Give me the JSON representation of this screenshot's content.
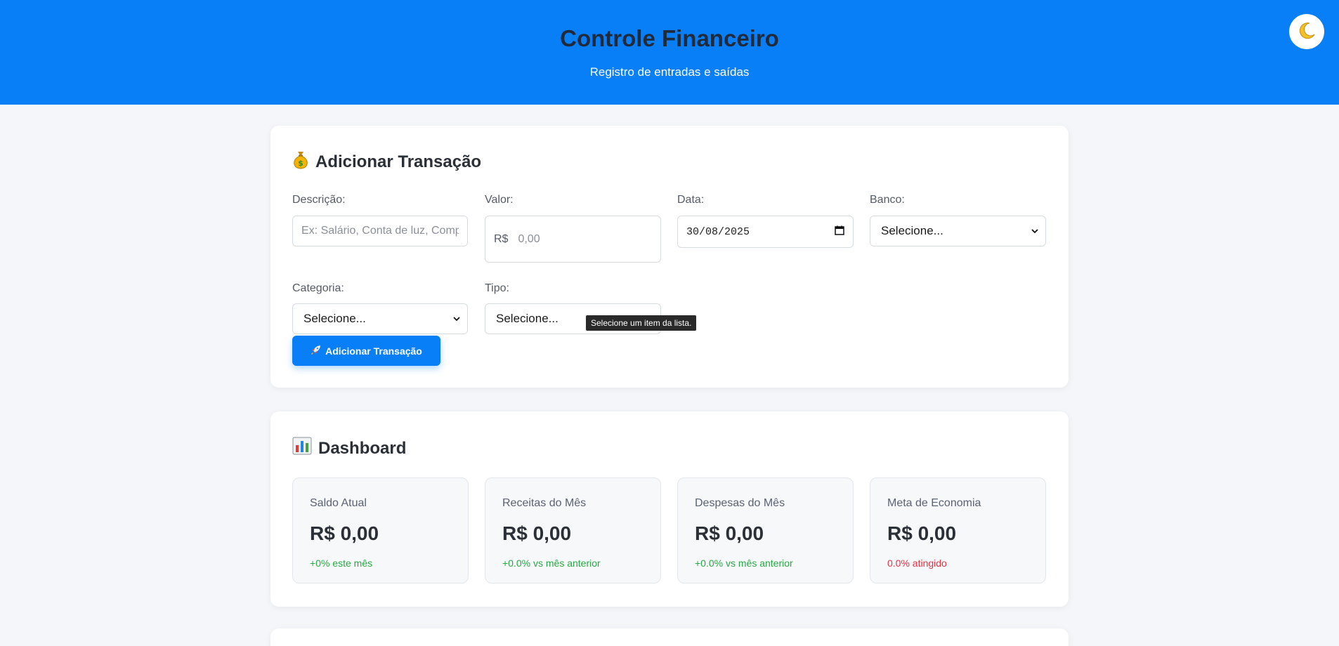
{
  "header": {
    "title": "Controle Financeiro",
    "subtitle": "Registro de entradas e saídas",
    "theme_toggle_icon": "crescent-moon-icon"
  },
  "form": {
    "title": "Adicionar Transação",
    "title_icon": "money-bag-icon",
    "description": {
      "label": "Descrição:",
      "placeholder": "Ex: Salário, Conta de luz, Compras",
      "value": ""
    },
    "amount": {
      "label": "Valor:",
      "prefix": "R$",
      "placeholder": "0,00",
      "value": ""
    },
    "date": {
      "label": "Data:",
      "value": "30/08/2025",
      "icon": "calendar-icon"
    },
    "bank": {
      "label": "Banco:",
      "selected": "Selecione..."
    },
    "category": {
      "label": "Categoria:",
      "selected": "Selecione..."
    },
    "type": {
      "label": "Tipo:",
      "selected": "Selecione..."
    },
    "tooltip": "Selecione um item da lista.",
    "submit": {
      "label": "Adicionar Transação",
      "icon": "rocket-icon"
    }
  },
  "dashboard": {
    "title": "Dashboard",
    "title_icon": "bar-chart-icon",
    "cards": [
      {
        "label": "Saldo Atual",
        "value": "R$ 0,00",
        "trend": "+0% este mês",
        "trend_color": "#28a745"
      },
      {
        "label": "Receitas do Mês",
        "value": "R$ 0,00",
        "trend": "+0.0% vs mês anterior",
        "trend_color": "#28a745"
      },
      {
        "label": "Despesas do Mês",
        "value": "R$ 0,00",
        "trend": "+0.0% vs mês anterior",
        "trend_color": "#28a745"
      },
      {
        "label": "Meta de Economia",
        "value": "R$ 0,00",
        "trend": "0.0% atingido",
        "trend_color": "#dc3545"
      }
    ]
  },
  "colors": {
    "primary": "#087ef7",
    "success": "#28a745",
    "danger": "#dc3545",
    "background": "#f4f6f9"
  }
}
